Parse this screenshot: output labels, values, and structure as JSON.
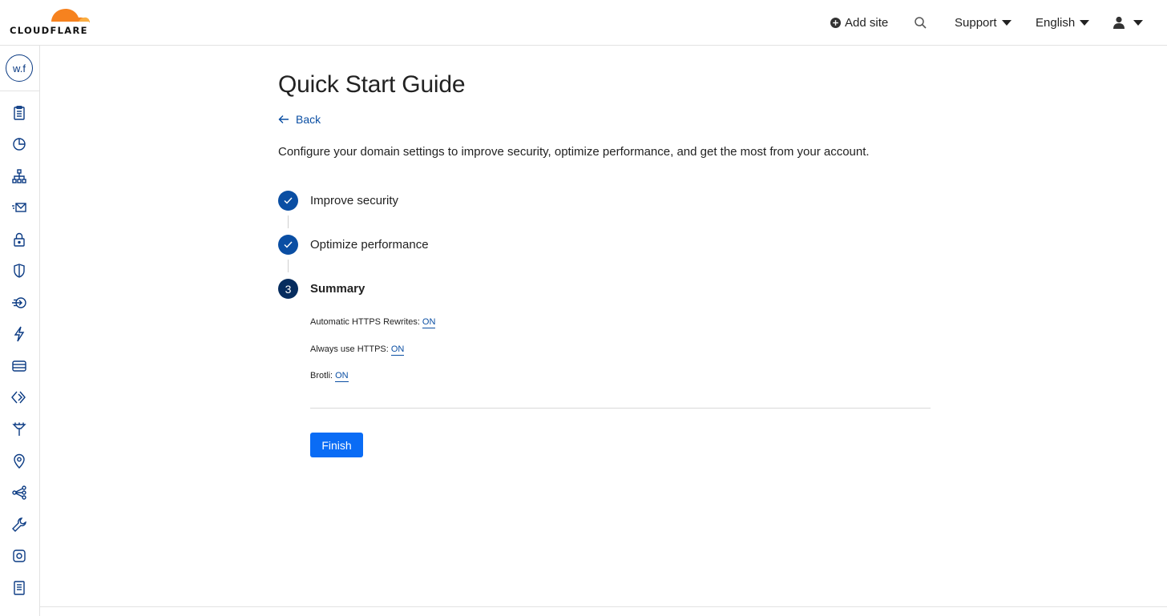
{
  "brand": {
    "name": "CLOUDFLARE",
    "orange": "#f6821f",
    "orange_light": "#fbad41"
  },
  "topbar": {
    "add_site_label": "Add site",
    "support_label": "Support",
    "language_label": "English",
    "icons": [
      "plus-circle-icon",
      "search-icon",
      "user-icon"
    ]
  },
  "sidebar": {
    "account_badge": "w.f",
    "items": [
      {
        "icon": "overview-icon"
      },
      {
        "icon": "analytics-icon"
      },
      {
        "icon": "dns-icon"
      },
      {
        "icon": "email-icon"
      },
      {
        "icon": "ssl-lock-icon"
      },
      {
        "icon": "security-shield-icon"
      },
      {
        "icon": "access-icon"
      },
      {
        "icon": "speed-bolt-icon"
      },
      {
        "icon": "caching-icon"
      },
      {
        "icon": "workers-icon"
      },
      {
        "icon": "rules-icon"
      },
      {
        "icon": "network-pin-icon"
      },
      {
        "icon": "traffic-icon"
      },
      {
        "icon": "custom-pages-wrench-icon"
      },
      {
        "icon": "apps-icon"
      },
      {
        "icon": "scrape-shield-icon"
      }
    ]
  },
  "main": {
    "title": "Quick Start Guide",
    "back_label": "Back",
    "intro": "Configure your domain settings to improve security, optimize performance, and get the most from your account.",
    "steps": [
      {
        "label": "Improve security",
        "status": "done"
      },
      {
        "label": "Optimize performance",
        "status": "done"
      },
      {
        "label": "Summary",
        "status": "current",
        "number": "3"
      }
    ],
    "summary": [
      {
        "label": "Automatic HTTPS Rewrites:",
        "value": "ON"
      },
      {
        "label": "Always use HTTPS:",
        "value": "ON"
      },
      {
        "label": "Brotli:",
        "value": "ON"
      }
    ],
    "finish_label": "Finish"
  },
  "colors": {
    "link": "#0a4ea3",
    "primary_button": "#0a6cf5",
    "step_done": "#0a4ea3",
    "step_current": "#062c5e",
    "sidebar_icon": "#0a3a83"
  }
}
